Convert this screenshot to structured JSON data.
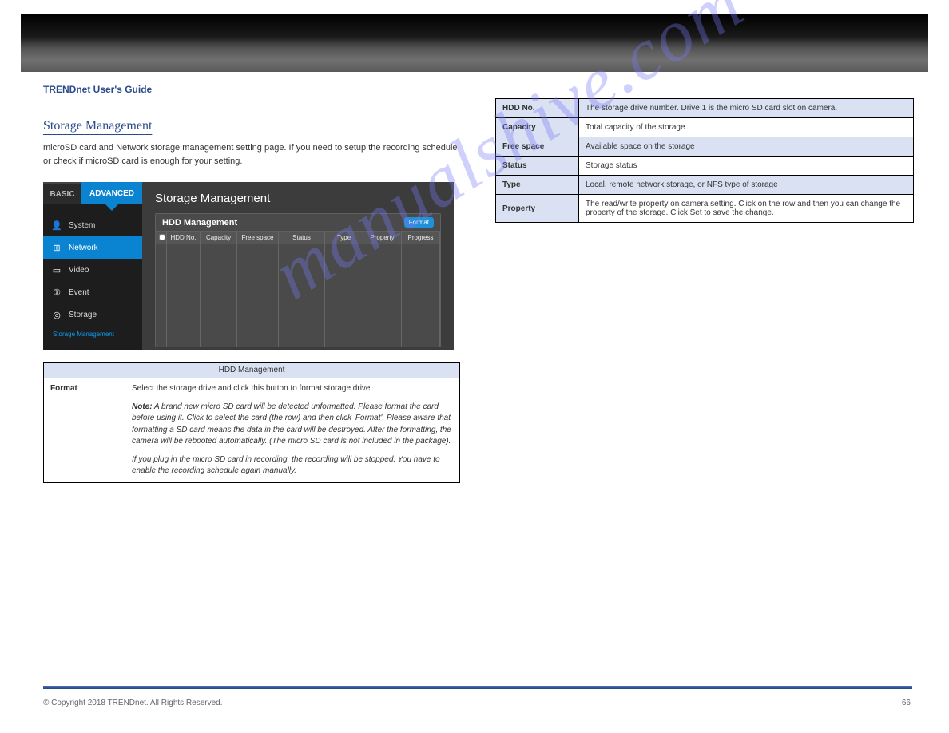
{
  "watermark": "manualshive.com",
  "header_label": "TRENDnet User's Guide",
  "section": {
    "title": "Storage Management",
    "body": "microSD card and Network storage management setting page. If you need to setup the recording schedule or check if microSD card is enough for your setting."
  },
  "screenshot": {
    "tabs": {
      "basic": "BASIC",
      "advanced": "ADVANCED"
    },
    "menu": [
      "System",
      "Network",
      "Video",
      "Event",
      "Storage"
    ],
    "active_menu_idx": 1,
    "subitem": "Storage Management",
    "main_title": "Storage Management",
    "panel_title": "HDD Management",
    "format_btn": "Format",
    "columns": [
      "",
      "HDD No.",
      "Capacity",
      "Free space",
      "Status",
      "Type",
      "Property",
      "Progress"
    ]
  },
  "left_table": {
    "header": "HDD Management",
    "row1_label": "Format",
    "row1_body_a": "Select the storage drive and click this button to format storage drive.",
    "row1_note_label": "Note:",
    "row1_note_body": "A brand new micro SD card will be detected unformatted. Please format the card before using it. Click to select the card (the row) and then click 'Format'. Please aware that formatting a SD card means the data in the card will be destroyed. After the formatting, the camera will be rebooted automatically. (The micro SD card is not included in the package).",
    "row1_note2": "If you plug in the micro SD card in recording, the recording will be stopped. You have to enable the recording schedule again manually."
  },
  "right_table": {
    "rows": [
      {
        "label": "HDD No.",
        "value": "The storage drive number. Drive 1 is the micro SD card slot on camera."
      },
      {
        "label": "Capacity",
        "value": "Total capacity of the storage"
      },
      {
        "label": "Free space",
        "value": "Available space on the storage"
      },
      {
        "label": "Status",
        "value": "Storage status"
      },
      {
        "label": "Type",
        "value": "Local, remote network storage, or NFS type of storage"
      },
      {
        "label": "Property",
        "value": "The read/write property on camera setting. Click on the row and then you can change the property of the storage. Click Set to save the change."
      }
    ]
  },
  "footer": {
    "copyright": "© Copyright 2018 TRENDnet. All Rights Reserved.",
    "page": "66"
  }
}
